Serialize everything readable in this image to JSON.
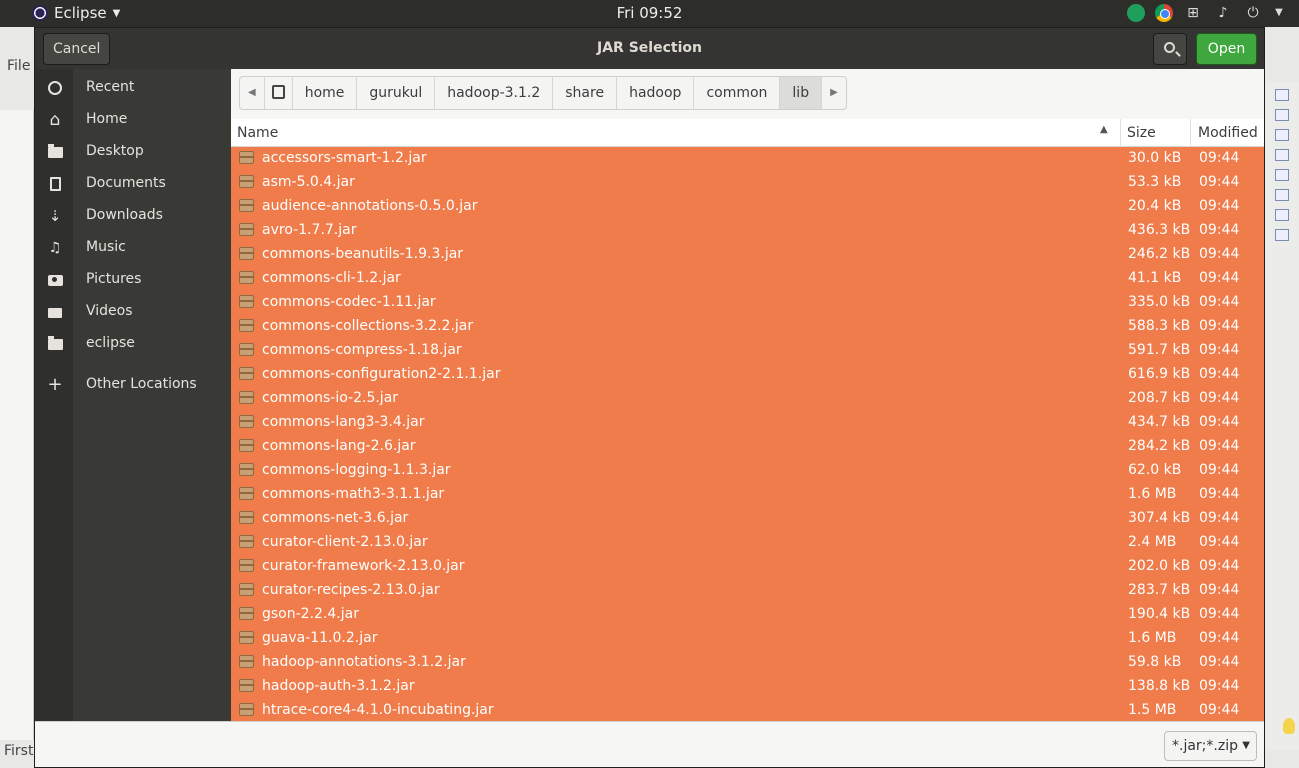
{
  "topbar": {
    "app_name": "Eclipse",
    "clock": "Fri 09:52"
  },
  "background_window": {
    "menu_file": "File",
    "status_text": "First"
  },
  "dialog": {
    "title": "JAR Selection",
    "cancel_label": "Cancel",
    "open_label": "Open",
    "filter_value": "*.jar;*.zip"
  },
  "sidebar": {
    "items": [
      {
        "label": "Recent",
        "icon": "clock-icon"
      },
      {
        "label": "Home",
        "icon": "home-icon"
      },
      {
        "label": "Desktop",
        "icon": "folder-icon"
      },
      {
        "label": "Documents",
        "icon": "document-icon"
      },
      {
        "label": "Downloads",
        "icon": "download-icon"
      },
      {
        "label": "Music",
        "icon": "music-icon"
      },
      {
        "label": "Pictures",
        "icon": "camera-icon"
      },
      {
        "label": "Videos",
        "icon": "video-icon"
      },
      {
        "label": "eclipse",
        "icon": "folder-icon"
      },
      {
        "label": "Other Locations",
        "icon": "plus-icon"
      }
    ]
  },
  "breadcrumb": [
    "home",
    "gurukul",
    "hadoop-3.1.2",
    "share",
    "hadoop",
    "common",
    "lib"
  ],
  "columns": {
    "name": "Name",
    "size": "Size",
    "modified": "Modified"
  },
  "files": [
    {
      "name": "accessors-smart-1.2.jar",
      "size": "30.0 kB",
      "modified": "09:44"
    },
    {
      "name": "asm-5.0.4.jar",
      "size": "53.3 kB",
      "modified": "09:44"
    },
    {
      "name": "audience-annotations-0.5.0.jar",
      "size": "20.4 kB",
      "modified": "09:44"
    },
    {
      "name": "avro-1.7.7.jar",
      "size": "436.3 kB",
      "modified": "09:44"
    },
    {
      "name": "commons-beanutils-1.9.3.jar",
      "size": "246.2 kB",
      "modified": "09:44"
    },
    {
      "name": "commons-cli-1.2.jar",
      "size": "41.1 kB",
      "modified": "09:44"
    },
    {
      "name": "commons-codec-1.11.jar",
      "size": "335.0 kB",
      "modified": "09:44"
    },
    {
      "name": "commons-collections-3.2.2.jar",
      "size": "588.3 kB",
      "modified": "09:44"
    },
    {
      "name": "commons-compress-1.18.jar",
      "size": "591.7 kB",
      "modified": "09:44"
    },
    {
      "name": "commons-configuration2-2.1.1.jar",
      "size": "616.9 kB",
      "modified": "09:44"
    },
    {
      "name": "commons-io-2.5.jar",
      "size": "208.7 kB",
      "modified": "09:44"
    },
    {
      "name": "commons-lang3-3.4.jar",
      "size": "434.7 kB",
      "modified": "09:44"
    },
    {
      "name": "commons-lang-2.6.jar",
      "size": "284.2 kB",
      "modified": "09:44"
    },
    {
      "name": "commons-logging-1.1.3.jar",
      "size": "62.0 kB",
      "modified": "09:44"
    },
    {
      "name": "commons-math3-3.1.1.jar",
      "size": "1.6 MB",
      "modified": "09:44"
    },
    {
      "name": "commons-net-3.6.jar",
      "size": "307.4 kB",
      "modified": "09:44"
    },
    {
      "name": "curator-client-2.13.0.jar",
      "size": "2.4 MB",
      "modified": "09:44"
    },
    {
      "name": "curator-framework-2.13.0.jar",
      "size": "202.0 kB",
      "modified": "09:44"
    },
    {
      "name": "curator-recipes-2.13.0.jar",
      "size": "283.7 kB",
      "modified": "09:44"
    },
    {
      "name": "gson-2.2.4.jar",
      "size": "190.4 kB",
      "modified": "09:44"
    },
    {
      "name": "guava-11.0.2.jar",
      "size": "1.6 MB",
      "modified": "09:44"
    },
    {
      "name": "hadoop-annotations-3.1.2.jar",
      "size": "59.8 kB",
      "modified": "09:44"
    },
    {
      "name": "hadoop-auth-3.1.2.jar",
      "size": "138.8 kB",
      "modified": "09:44"
    },
    {
      "name": "htrace-core4-4.1.0-incubating.jar",
      "size": "1.5 MB",
      "modified": "09:44"
    }
  ],
  "colors": {
    "selection": "#ef7c4a",
    "open_button": "#3ea83e",
    "sidebar": "#393936",
    "header": "#343432"
  }
}
